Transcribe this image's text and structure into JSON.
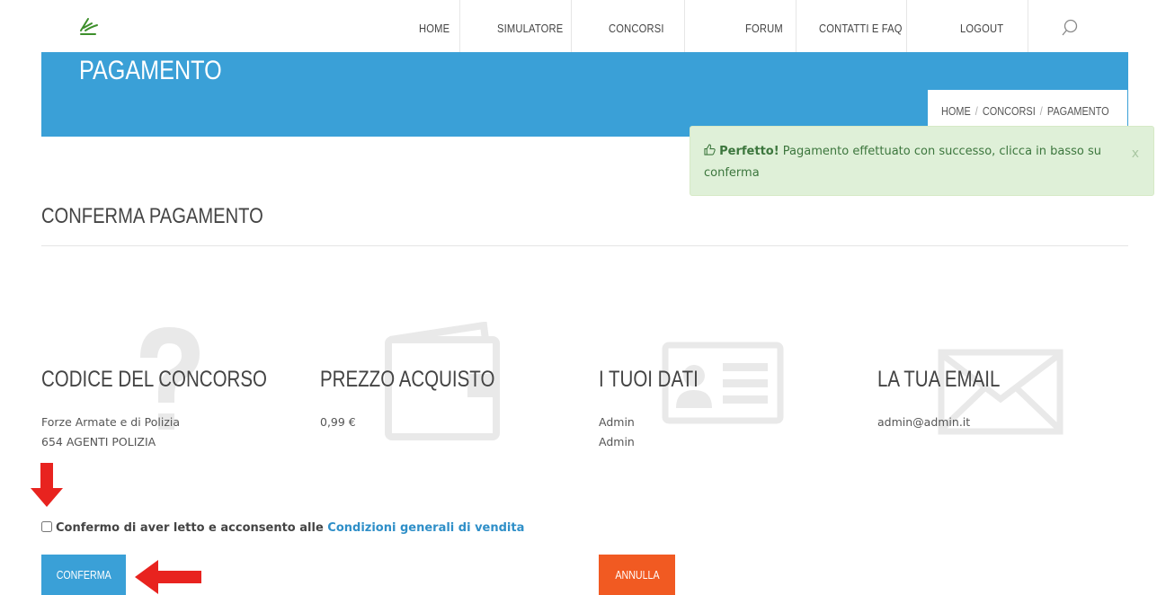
{
  "nav": {
    "items": [
      "HOME",
      "SIMULATORE",
      "CONCORSI",
      "FORUM",
      "CONTATTI E FAQ",
      "LOGOUT"
    ]
  },
  "banner": {
    "title": "PAGAMENTO",
    "breadcrumb": [
      "HOME",
      "CONCORSI",
      "PAGAMENTO"
    ],
    "separator": "/"
  },
  "alert": {
    "strong": "Perfetto!",
    "message": " Pagamento effettuato con successo, clicca in basso su conferma",
    "close": "x"
  },
  "section": {
    "title": "CONFERMA PAGAMENTO"
  },
  "columns": [
    {
      "title": "CODICE DEL CONCORSO",
      "lines": [
        "Forze Armate e di Polizia",
        "654 AGENTI POLIZIA"
      ],
      "icon": "question-icon"
    },
    {
      "title": "PREZZO ACQUISTO",
      "lines": [
        "0,99 €"
      ],
      "icon": "wallet-icon"
    },
    {
      "title": "I TUOI DATI",
      "lines": [
        "Admin",
        "Admin"
      ],
      "icon": "id-card-icon"
    },
    {
      "title": "LA TUA EMAIL",
      "lines": [
        "admin@admin.it"
      ],
      "icon": "envelope-icon"
    }
  ],
  "agreement": {
    "text": "Confermo di aver letto e acconsento alle ",
    "link": "Condizioni generali di vendita",
    "checked": false
  },
  "buttons": {
    "confirm": "CONFERMA",
    "cancel": "ANNULLA"
  },
  "colors": {
    "primary": "#3aa0d7",
    "danger": "#f15a22",
    "success_bg": "#dff0d8",
    "annotation_arrow": "#e8231f"
  }
}
